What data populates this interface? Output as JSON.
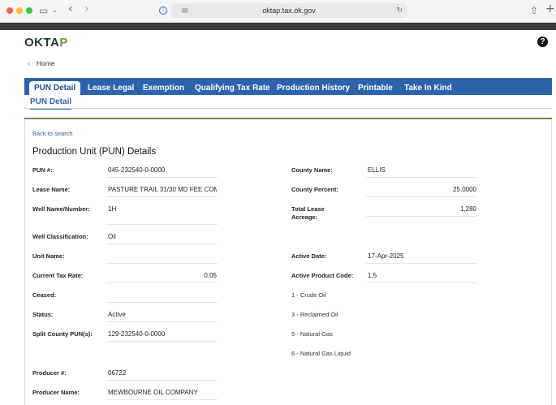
{
  "browser": {
    "url": "oktap.tax.ok.gov"
  },
  "app": {
    "logo_main": "OKTA",
    "logo_accent": "P",
    "help_symbol": "?",
    "home_label": "Home"
  },
  "tabs": [
    {
      "label": "PUN Detail",
      "active": true
    },
    {
      "label": "Lease Legal",
      "active": false
    },
    {
      "label": "Exemption",
      "active": false
    },
    {
      "label": "Qualifying Tax Rate",
      "active": false
    },
    {
      "label": "Production History",
      "active": false
    },
    {
      "label": "Printable",
      "active": false
    },
    {
      "label": "Take In Kind",
      "active": false
    }
  ],
  "subtab": "PUN Detail",
  "back_link": "Back to search",
  "title": "Production Unit (PUN) Details",
  "left_fields": [
    {
      "label": "PUN #:",
      "value": "045-232540-0-0000"
    },
    {
      "label": "Lease Name:",
      "value": "PASTURE TRAIL 31/30 MD FEE COM"
    },
    {
      "label": "Well Name/Number:",
      "value": "1H"
    },
    {
      "label": "Well Classification:",
      "value": "Oil"
    },
    {
      "label": "Unit Name:",
      "value": ""
    },
    {
      "label": "Current Tax Rate:",
      "value": "0.05"
    },
    {
      "label": "Ceased:",
      "value": ""
    },
    {
      "label": "Status:",
      "value": "Active"
    },
    {
      "label": "Split County PUN(s):",
      "value": "129-232540-0-0000"
    },
    {
      "label": "Producer #:",
      "value": "06722"
    },
    {
      "label": "Producer Name:",
      "value": "MEWBOURNE OIL COMPANY"
    }
  ],
  "right_fields": [
    {
      "label": "County Name:",
      "value": "ELLIS"
    },
    {
      "label": "County Percent:",
      "value": "25.0000"
    },
    {
      "label_line1": "Total Lease",
      "label_line2": "Acreage:",
      "value": "1,280"
    },
    {
      "label": "Active Date:",
      "value": "17-Apr-2025"
    },
    {
      "label": "Active Product Code:",
      "value": "1,5"
    }
  ],
  "product_codes": [
    "1 - Crude Oil",
    "3 - Reclaimed Oil",
    "5 - Natural Gas",
    "6 - Natural Gas Liquid"
  ],
  "colors": {
    "tab_bar": "#2d63ad",
    "accent_green": "#5f8f3a",
    "link": "#2b5f9e"
  }
}
